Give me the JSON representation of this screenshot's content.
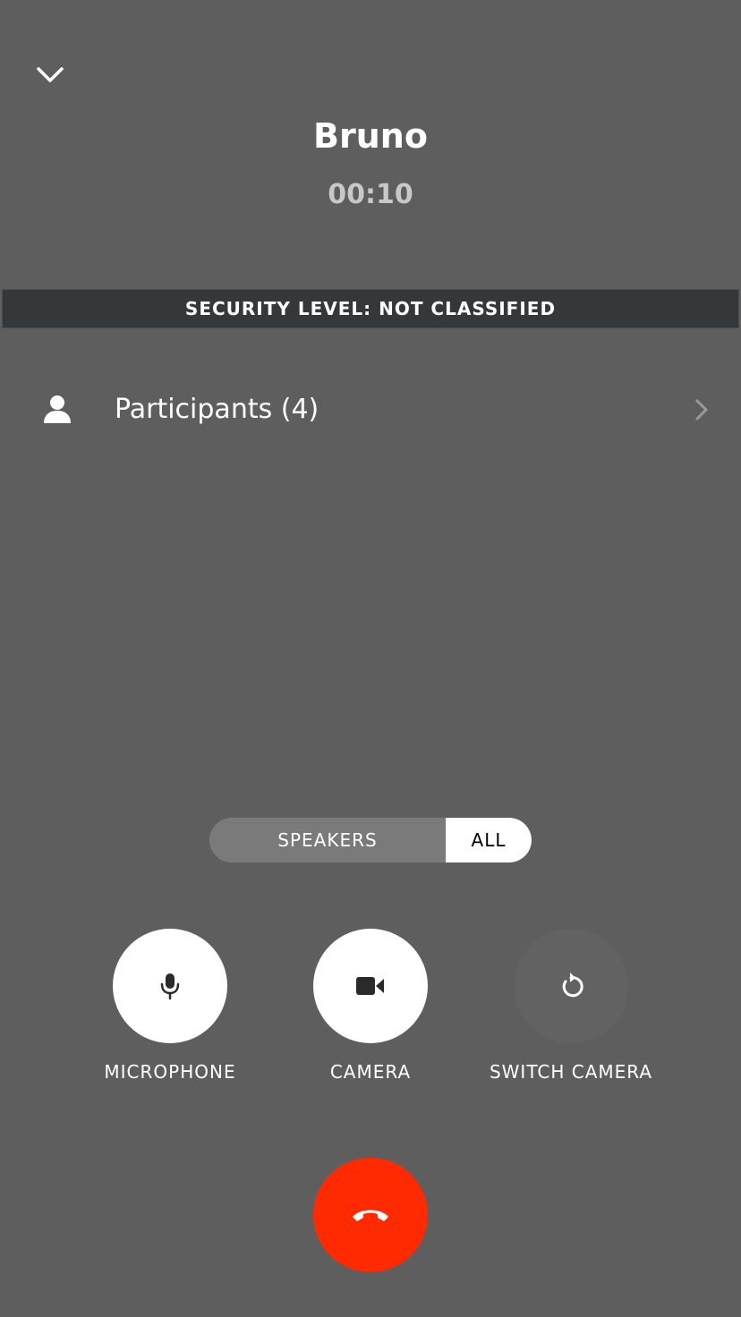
{
  "header": {
    "collapse_icon": "chevron-down-icon",
    "caller_name": "Bruno",
    "timer": "00:10"
  },
  "security": {
    "label": "SECURITY LEVEL: NOT CLASSIFIED"
  },
  "participants": {
    "icon": "person-icon",
    "label": "Participants (4)",
    "chevron_icon": "chevron-right-icon"
  },
  "view_toggle": {
    "options": [
      "SPEAKERS",
      "ALL"
    ],
    "selected": "ALL"
  },
  "controls": [
    {
      "icon": "microphone-icon",
      "label": "MICROPHONE",
      "state": "on"
    },
    {
      "icon": "video-camera-icon",
      "label": "CAMERA",
      "state": "on"
    },
    {
      "icon": "switch-camera-icon",
      "label": "SWITCH CAMERA",
      "state": "off"
    }
  ],
  "end_call": {
    "icon": "hang-up-icon"
  },
  "colors": {
    "background": "#5e5e5e",
    "security_bar": "#35383b",
    "end_call": "#ff2a00",
    "timer_text": "#c8c8c8"
  }
}
